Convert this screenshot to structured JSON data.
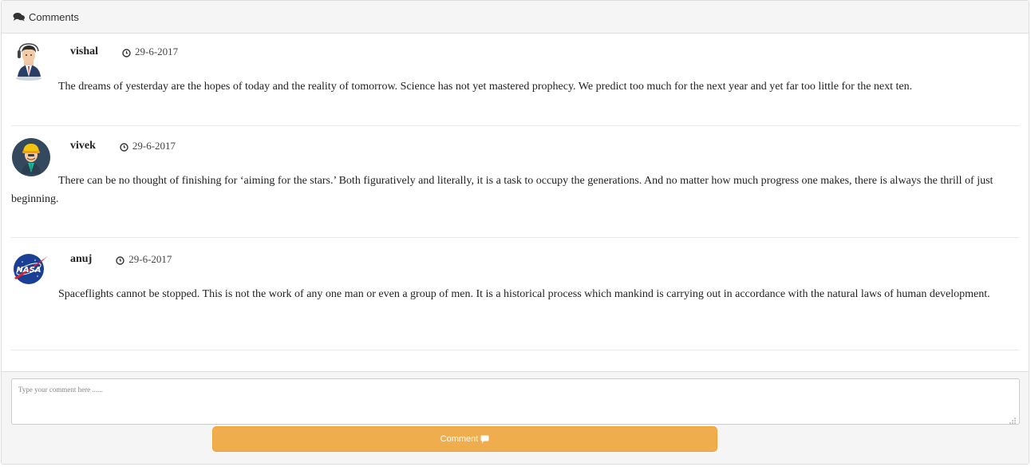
{
  "panel": {
    "title": "Comments",
    "title_icon": "comments-icon"
  },
  "comments": [
    {
      "author": "vishal",
      "date": "29-6-2017",
      "avatar": "businessman-avatar",
      "text": "The dreams of yesterday are the hopes of today and the reality of tomorrow. Science has not yet mastered prophecy. We predict too much for the next year and yet far too little for the next ten."
    },
    {
      "author": "vivek",
      "date": "29-6-2017",
      "avatar": "worker-avatar",
      "text": "There can be no thought of finishing for ‘aiming for the stars.’ Both figuratively and literally, it is a task to occupy the generations. And no matter how much progress one makes, there is always the thrill of just beginning."
    },
    {
      "author": "anuj",
      "date": "29-6-2017",
      "avatar": "nasa-logo-avatar",
      "text": "Spaceflights cannot be stopped. This is not the work of any one man or even a group of men. It is a historical process which mankind is carrying out in accordance with the natural laws of human development."
    }
  ],
  "form": {
    "placeholder": "Type your comment here ......",
    "value": "",
    "button_label": "Comment",
    "button_icon": "comment-bubble-icon"
  },
  "colors": {
    "button": "#f0ad4e",
    "panel_heading": "#f5f5f5",
    "border": "#dddddd"
  }
}
